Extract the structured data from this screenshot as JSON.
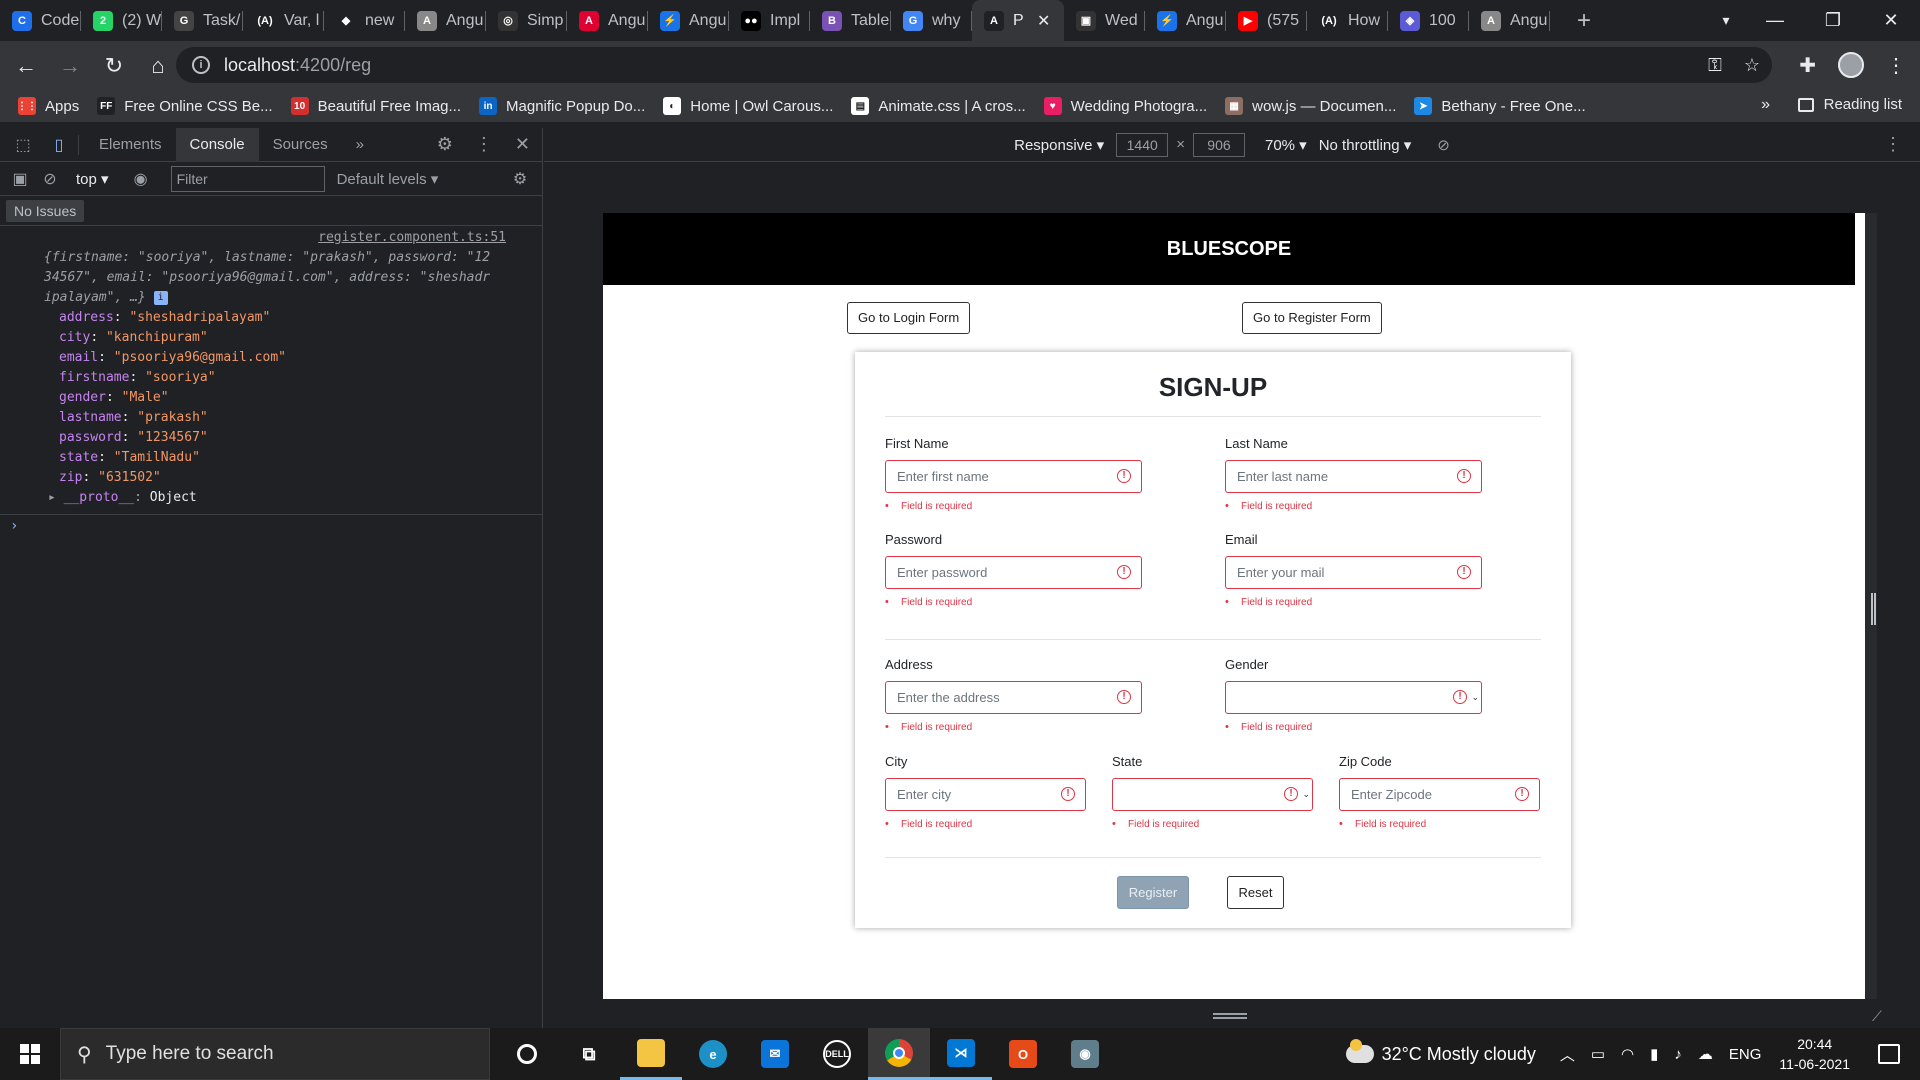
{
  "browser": {
    "tabs": [
      {
        "title": "Code",
        "color": "#1f6feb",
        "glyph": "C"
      },
      {
        "title": "(2) W",
        "color": "#25d366",
        "glyph": "2"
      },
      {
        "title": "Task/",
        "color": "#444444",
        "glyph": "G"
      },
      {
        "title": "Var, l",
        "color": "#202124",
        "glyph": "(A)"
      },
      {
        "title": "new",
        "color": "#202124",
        "glyph": "◆"
      },
      {
        "title": "Angu",
        "color": "#888888",
        "glyph": "A"
      },
      {
        "title": "Simp",
        "color": "#333333",
        "glyph": "◎"
      },
      {
        "title": "Angu",
        "color": "#dd0031",
        "glyph": "A"
      },
      {
        "title": "Angu",
        "color": "#1a73e8",
        "glyph": "⚡"
      },
      {
        "title": "Impl",
        "color": "#000000",
        "glyph": "●●"
      },
      {
        "title": "Table",
        "color": "#7952b3",
        "glyph": "B"
      },
      {
        "title": "why",
        "color": "#4285f4",
        "glyph": "G"
      },
      {
        "title": "P",
        "color": "#202124",
        "glyph": "A",
        "active": true
      },
      {
        "title": "Wed",
        "color": "#333333",
        "glyph": "▣"
      },
      {
        "title": "Angu",
        "color": "#1a73e8",
        "glyph": "⚡"
      },
      {
        "title": "(575",
        "color": "#ff0000",
        "glyph": "▶"
      },
      {
        "title": "How",
        "color": "#202124",
        "glyph": "(A)"
      },
      {
        "title": "100",
        "color": "#5b5bd6",
        "glyph": "◈"
      },
      {
        "title": "Angu",
        "color": "#888888",
        "glyph": "A"
      }
    ],
    "url_host": "localhost",
    "url_path": ":4200/reg",
    "bookmarks": [
      {
        "label": "Apps",
        "color": "#ea4335",
        "glyph": "⋮⋮"
      },
      {
        "label": "Free Online CSS Be...",
        "color": "#202124",
        "glyph": "FF"
      },
      {
        "label": "Beautiful Free Imag...",
        "color": "#d32f2f",
        "glyph": "10"
      },
      {
        "label": "Magnific Popup Do...",
        "color": "#0a66c2",
        "glyph": "in"
      },
      {
        "label": "Home | Owl Carous...",
        "color": "#ffffff",
        "glyph": "◐"
      },
      {
        "label": "Animate.css | A cros...",
        "color": "#ffffff",
        "glyph": "▤"
      },
      {
        "label": "Wedding Photogra...",
        "color": "#e91e63",
        "glyph": "♥"
      },
      {
        "label": "wow.js — Documen...",
        "color": "#8d6e63",
        "glyph": "▦"
      },
      {
        "label": "Bethany - Free One...",
        "color": "#1e88e5",
        "glyph": "➤"
      }
    ],
    "reading_list": "Reading list"
  },
  "devtools": {
    "tabs": [
      "Elements",
      "Console",
      "Sources"
    ],
    "active_tab": "Console",
    "context": "top",
    "filter_placeholder": "Filter",
    "levels": "Default levels",
    "issues": "No Issues",
    "source_link": "register.component.ts:51",
    "summary_lines": [
      "{firstname: \"sooriya\", lastname: \"prakash\", password: \"12",
      "34567\", email: \"psooriya96@gmail.com\", address: \"sheshadr",
      "ipalayam\", …}"
    ],
    "properties": [
      {
        "key": "address",
        "value": "\"sheshadripalayam\""
      },
      {
        "key": "city",
        "value": "\"kanchipuram\""
      },
      {
        "key": "email",
        "value": "\"psooriya96@gmail.com\""
      },
      {
        "key": "firstname",
        "value": "\"sooriya\""
      },
      {
        "key": "gender",
        "value": "\"Male\""
      },
      {
        "key": "lastname",
        "value": "\"prakash\""
      },
      {
        "key": "password",
        "value": "\"1234567\""
      },
      {
        "key": "state",
        "value": "\"TamilNadu\""
      },
      {
        "key": "zip",
        "value": "\"631502\""
      }
    ],
    "proto_key": "__proto__",
    "proto_value": "Object"
  },
  "device_toolbar": {
    "device": "Responsive",
    "width": "1440",
    "height": "906",
    "zoom": "70%",
    "throttling": "No throttling"
  },
  "app": {
    "brand": "BLUESCOPE",
    "login_button": "Go to Login Form",
    "register_nav_button": "Go to Register Form",
    "form_title": "SIGN-UP",
    "error_text": "Field is required",
    "fields": {
      "firstname": {
        "label": "First Name",
        "placeholder": "Enter first name"
      },
      "lastname": {
        "label": "Last Name",
        "placeholder": "Enter last name"
      },
      "password": {
        "label": "Password",
        "placeholder": "Enter password"
      },
      "email": {
        "label": "Email",
        "placeholder": "Enter your mail"
      },
      "address": {
        "label": "Address",
        "placeholder": "Enter the address"
      },
      "gender": {
        "label": "Gender",
        "placeholder": ""
      },
      "city": {
        "label": "City",
        "placeholder": "Enter city"
      },
      "state": {
        "label": "State",
        "placeholder": ""
      },
      "zip": {
        "label": "Zip Code",
        "placeholder": "Enter Zipcode"
      }
    },
    "register_button": "Register",
    "reset_button": "Reset",
    "error_color": "#dc3545"
  },
  "taskbar": {
    "search_placeholder": "Type here to search",
    "weather": "32°C  Mostly cloudy",
    "language": "ENG",
    "time": "20:44",
    "date": "11-06-2021"
  }
}
